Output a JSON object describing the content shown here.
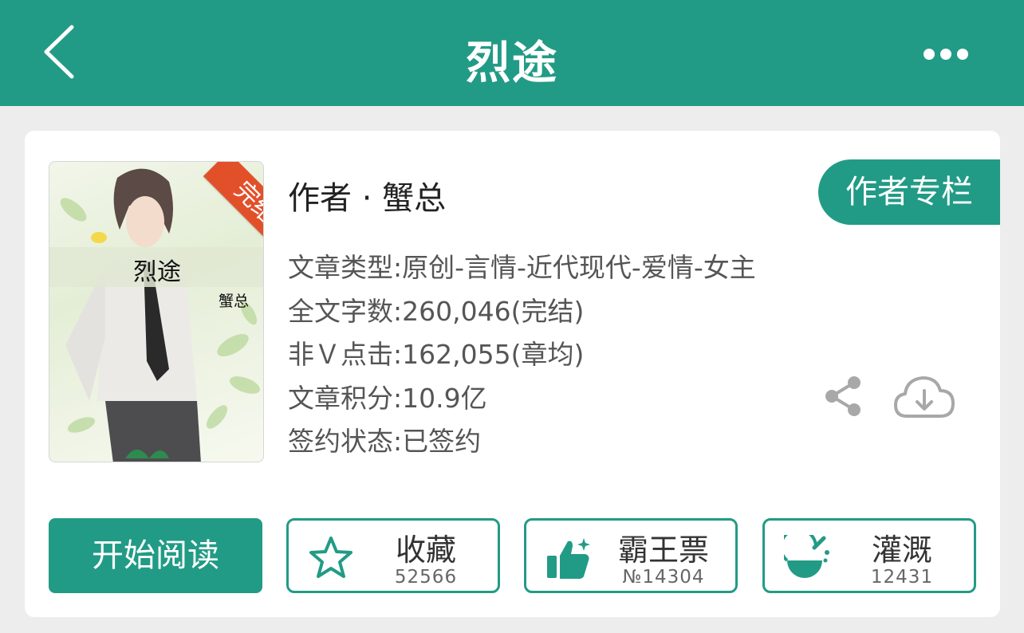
{
  "header": {
    "title": "烈途",
    "back_icon": "chevron-left-icon",
    "more_icon": "more-horizontal-icon",
    "bg_color": "#229b86"
  },
  "book": {
    "cover": {
      "title": "烈途",
      "author": "蟹总",
      "ribbon": "完结"
    },
    "author_line": "作者 · 蟹总",
    "author_column_button": "作者专栏",
    "info": [
      "文章类型:原创-言情-近代现代-爱情-女主",
      "全文字数:260,046(完结)",
      "非Ｖ点击:162,055(章均)",
      "文章积分:10.9亿",
      "签约状态:已签约"
    ],
    "share_icon": "share-icon",
    "download_icon": "cloud-download-icon"
  },
  "actions": {
    "read_label": "开始阅读",
    "collect": {
      "label": "收藏",
      "count": "52566",
      "icon": "star-icon"
    },
    "vote": {
      "label": "霸王票",
      "count": "№14304",
      "icon": "thumbs-up-icon"
    },
    "water": {
      "label": "灌溉",
      "count": "12431",
      "icon": "flask-icon"
    }
  },
  "colors": {
    "accent": "#229b86",
    "ribbon": "#e2502a",
    "background": "#ededed"
  }
}
